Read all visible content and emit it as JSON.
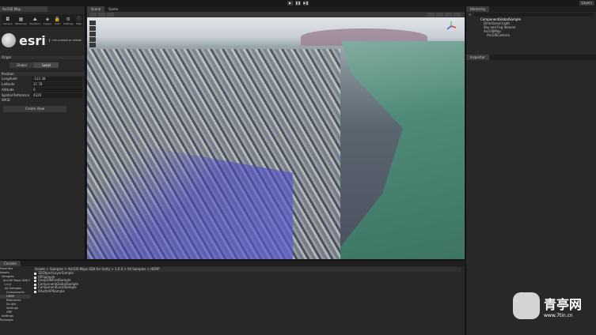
{
  "toolbar": {
    "play": "▶",
    "pause": "❚❚",
    "step": "▶❚",
    "layers": "Layers"
  },
  "left_panel": {
    "tab": "ArcGIS Map",
    "tools": [
      {
        "icon": "camera-icon",
        "glyph": "◘",
        "label": "Camera"
      },
      {
        "icon": "basemap-icon",
        "glyph": "▦",
        "label": "Basemap"
      },
      {
        "icon": "elevation-icon",
        "glyph": "⛰",
        "label": "Elevation"
      },
      {
        "icon": "layers-icon",
        "glyph": "◈",
        "label": "Layers"
      },
      {
        "icon": "auth-icon",
        "glyph": "🔒",
        "label": "Auth"
      },
      {
        "icon": "settings-icon",
        "glyph": "⚙",
        "label": "Settings"
      },
      {
        "icon": "help-icon",
        "glyph": "ⓘ",
        "label": "Help"
      }
    ],
    "logo": "esri",
    "tagline": "THE SCIENCE OF WHERE",
    "origin": "Origin",
    "global": "Global",
    "local": "Local",
    "position": "Position",
    "fields": [
      {
        "label": "Longitude",
        "value": "-122.38"
      },
      {
        "label": "Latitude",
        "value": "37.78"
      },
      {
        "label": "Altitude",
        "value": "0"
      },
      {
        "label": "Spatial Reference WKID",
        "value": "4326"
      }
    ],
    "create_view": "Create View"
  },
  "scene": {
    "tabs": [
      "Scene",
      "Game"
    ]
  },
  "hierarchy": {
    "tab": "Hierarchy",
    "items": [
      "ComponentGlobalSample",
      "Directional Light",
      "Sky and Fog Volume",
      "ArcGISMap",
      "ArcGISCamera"
    ]
  },
  "inspector": {
    "tab": "Inspector"
  },
  "console": {
    "tab": "Console",
    "breadcrumb": "Assets > Samples > ArcGIS Maps SDK for Unity > 1.0.0 > All Samples > HDRP",
    "tree": [
      "Favorites",
      "Assets",
      "Samples",
      "ArcGIS Maps SDK for U",
      "1.0.0",
      "All Samples",
      "Components",
      "HDRP",
      "Resources",
      "Scripts",
      "Settings",
      "URP",
      "Settings",
      "Packages"
    ],
    "files": [
      "3DObjectLayerSample",
      "APISample",
      "GeoJSONFeatSample",
      "ComponentGlobalSample",
      "ComponentLocalSample",
      "OAuthAPISample"
    ]
  },
  "watermark": {
    "name": "青亭网",
    "url": "www.7tin.cn"
  }
}
